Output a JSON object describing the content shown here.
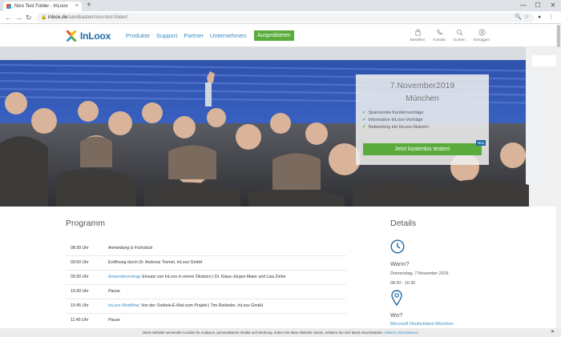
{
  "browser": {
    "tab_title": "Nico Test Folder - InLoox",
    "tab_close": "×",
    "new_tab": "+",
    "url_host": "inloox.de",
    "url_path": "/sandkasten/nico-test-folder/",
    "win_min": "—",
    "win_max": "☐",
    "win_close": "✕"
  },
  "header": {
    "logo_text": "InLoox",
    "nav": [
      "Produkte",
      "Support",
      "Partner",
      "Unternehmen"
    ],
    "cta": "Ausprobieren",
    "actions": [
      "Bestellen",
      "Kontakt",
      "Suchen",
      "Einloggen"
    ]
  },
  "hero": {
    "date": "7.November2019",
    "city": "München",
    "bullets": [
      "Spannende Kundenvorträge",
      "Informative InLoox-Vorträge",
      "Networking mit InLoox-Nutzern"
    ],
    "button": "Jetzt kostenlos testen!",
    "badge": "Neu"
  },
  "program": {
    "title": "Programm",
    "rows": [
      {
        "time": "08:30 Uhr",
        "link": "",
        "text": "Anmeldung & Frühstück",
        "italic": true
      },
      {
        "time": "09:00 Uhr",
        "link": "",
        "text": "Eröffnung durch Dr. Andreas Tremel, InLoox GmbH",
        "italic": false
      },
      {
        "time": "09:30 Uhr",
        "link": "Anwendervortrag",
        "text": ": Einsatz von InLoox in einem Ökobüro | Dr. Klaus-Jürgen Maier und Lisa Ziehe",
        "italic": false
      },
      {
        "time": "10:30 Uhr",
        "link": "",
        "text": "Pause",
        "italic": true
      },
      {
        "time": "10:45 Uhr",
        "link": "InLoox Workflow",
        "text": ": Von der Outlook-E-Mail zum Projekt | Tim Rohleder, InLoox GmbH",
        "italic": false
      },
      {
        "time": "11:45 Uhr",
        "link": "",
        "text": "Pause",
        "italic": true
      }
    ]
  },
  "details": {
    "title": "Details",
    "when_label": "Wann?",
    "when_date": "Donnerstag, 7.November 2019",
    "when_time": "08:30 - 16:30",
    "where_label": "Wo?",
    "where_link": "Microsoft Deutschland München"
  },
  "cookie": {
    "text": "Diese Website verwendet Cookies für Analysen, personalisierte Inhalte und Werbung. Indem Sie diese Website nutzen, erklären Sie sich damit einverstanden.",
    "link": "Weitere Informationen",
    "close": "✕"
  },
  "colors": {
    "brand_blue": "#1f6aa5",
    "link_blue": "#3a8dc4",
    "green": "#5aab3c"
  }
}
